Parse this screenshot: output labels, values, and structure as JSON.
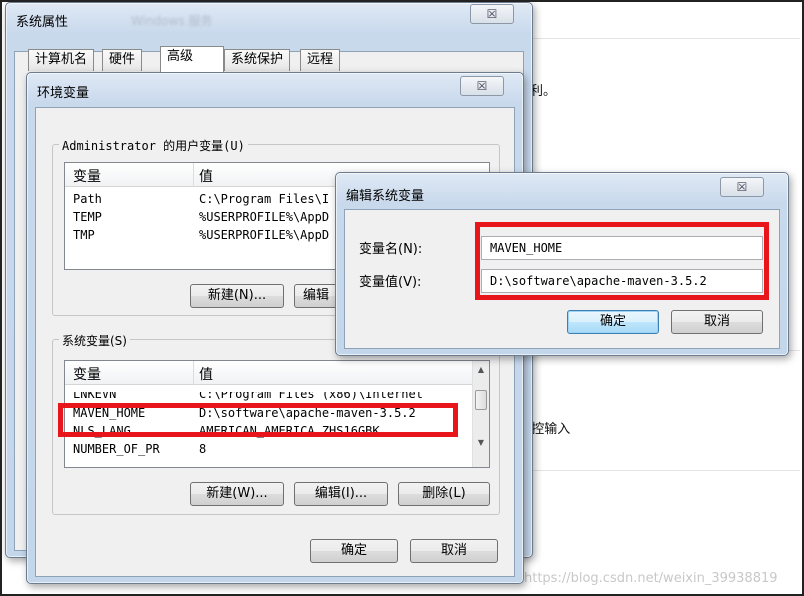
{
  "background": {
    "blurred_title": "Windows 服务",
    "text_fragment_1": "利。",
    "text_fragment_2": "!控输入",
    "watermark": "https://blog.csdn.net/weixin_39938819"
  },
  "system_properties": {
    "title": "系统属性",
    "close_glyph": "☒",
    "tabs": [
      "计算机名",
      "硬件",
      "高级",
      "系统保护",
      "远程"
    ]
  },
  "env_vars": {
    "title": "环境变量",
    "close_glyph": "☒",
    "user_group_label": "Administrator 的用户变量(U)",
    "user_columns": [
      "变量",
      "值"
    ],
    "user_rows": [
      {
        "name": "Path",
        "value": "C:\\Program Files\\I"
      },
      {
        "name": "TEMP",
        "value": "%USERPROFILE%\\AppD"
      },
      {
        "name": "TMP",
        "value": "%USERPROFILE%\\AppD"
      }
    ],
    "user_new_button": "新建(N)...",
    "user_edit_button": "编辑",
    "system_group_label": "系统变量(S)",
    "system_columns": [
      "变量",
      "值"
    ],
    "system_rows": [
      {
        "name": "LNKEVN",
        "value": "C:\\Program Files (x86)\\Internet"
      },
      {
        "name": "MAVEN_HOME",
        "value": "D:\\software\\apache-maven-3.5.2"
      },
      {
        "name": "NLS_LANG",
        "value": "AMERICAN_AMERICA.ZHS16GBK"
      },
      {
        "name": "NUMBER_OF_PR",
        "value": "8"
      }
    ],
    "system_new_button": "新建(W)...",
    "system_edit_button": "编辑(I)...",
    "system_delete_button": "删除(L)",
    "ok_button": "确定",
    "cancel_button": "取消"
  },
  "edit_dialog": {
    "title": "编辑系统变量",
    "close_glyph": "☒",
    "name_label": "变量名(N):",
    "name_value": "MAVEN_HOME",
    "value_label": "变量值(V):",
    "value_value": "D:\\software\\apache-maven-3.5.2",
    "ok_button": "确定",
    "cancel_button": "取消"
  },
  "colors": {
    "highlight_red": "#e8151b",
    "window_frame": "#c4d6ea"
  }
}
